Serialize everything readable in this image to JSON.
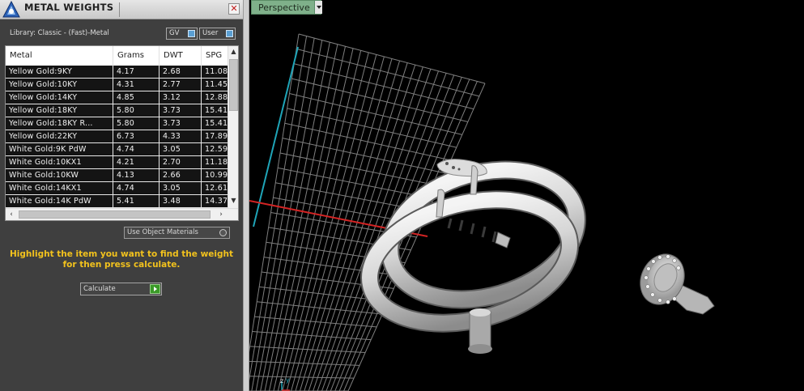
{
  "panel": {
    "title": "METAL WEIGHTS",
    "close_glyph": "✕",
    "library_label": "Library: Classic - (Fast)-Metal",
    "toggles": [
      {
        "label": "GV",
        "on": true
      },
      {
        "label": "User",
        "on": true
      }
    ],
    "table": {
      "columns": [
        "Metal",
        "Grams",
        "DWT",
        "SPG"
      ],
      "rows": [
        [
          "Yellow Gold:9KY",
          "4.17",
          "2.68",
          "11.08"
        ],
        [
          "Yellow Gold:10KY",
          "4.31",
          "2.77",
          "11.45"
        ],
        [
          "Yellow Gold:14KY",
          "4.85",
          "3.12",
          "12.88"
        ],
        [
          "Yellow Gold:18KY",
          "5.80",
          "3.73",
          "15.41"
        ],
        [
          "Yellow Gold:18KY R...",
          "5.80",
          "3.73",
          "15.41"
        ],
        [
          "Yellow Gold:22KY",
          "6.73",
          "4.33",
          "17.89"
        ],
        [
          "White Gold:9K PdW",
          "4.74",
          "3.05",
          "12.59"
        ],
        [
          "White Gold:10KX1",
          "4.21",
          "2.70",
          "11.18"
        ],
        [
          "White Gold:10KW",
          "4.13",
          "2.66",
          "10.99"
        ],
        [
          "White Gold:14KX1",
          "4.74",
          "3.05",
          "12.61"
        ],
        [
          "White Gold:14K PdW",
          "5.41",
          "3.48",
          "14.37"
        ]
      ]
    },
    "use_object_materials_label": "Use Object Materials",
    "instruction": "Highlight the item you want to find the weight for then press calculate.",
    "calculate_label": "Calculate"
  },
  "viewport": {
    "label": "Perspective",
    "axis_label_z": "z",
    "axis_label_y": "y"
  },
  "colors": {
    "instruction_text": "#f2c21d",
    "viewport_label_bg": "#7fb08a",
    "grid_line": "#7f7f7f",
    "axis_x": "#d32424",
    "axis_y": "#1fa5b8",
    "calculate_go": "#3a9a27",
    "table_row_bg": "#141414"
  }
}
